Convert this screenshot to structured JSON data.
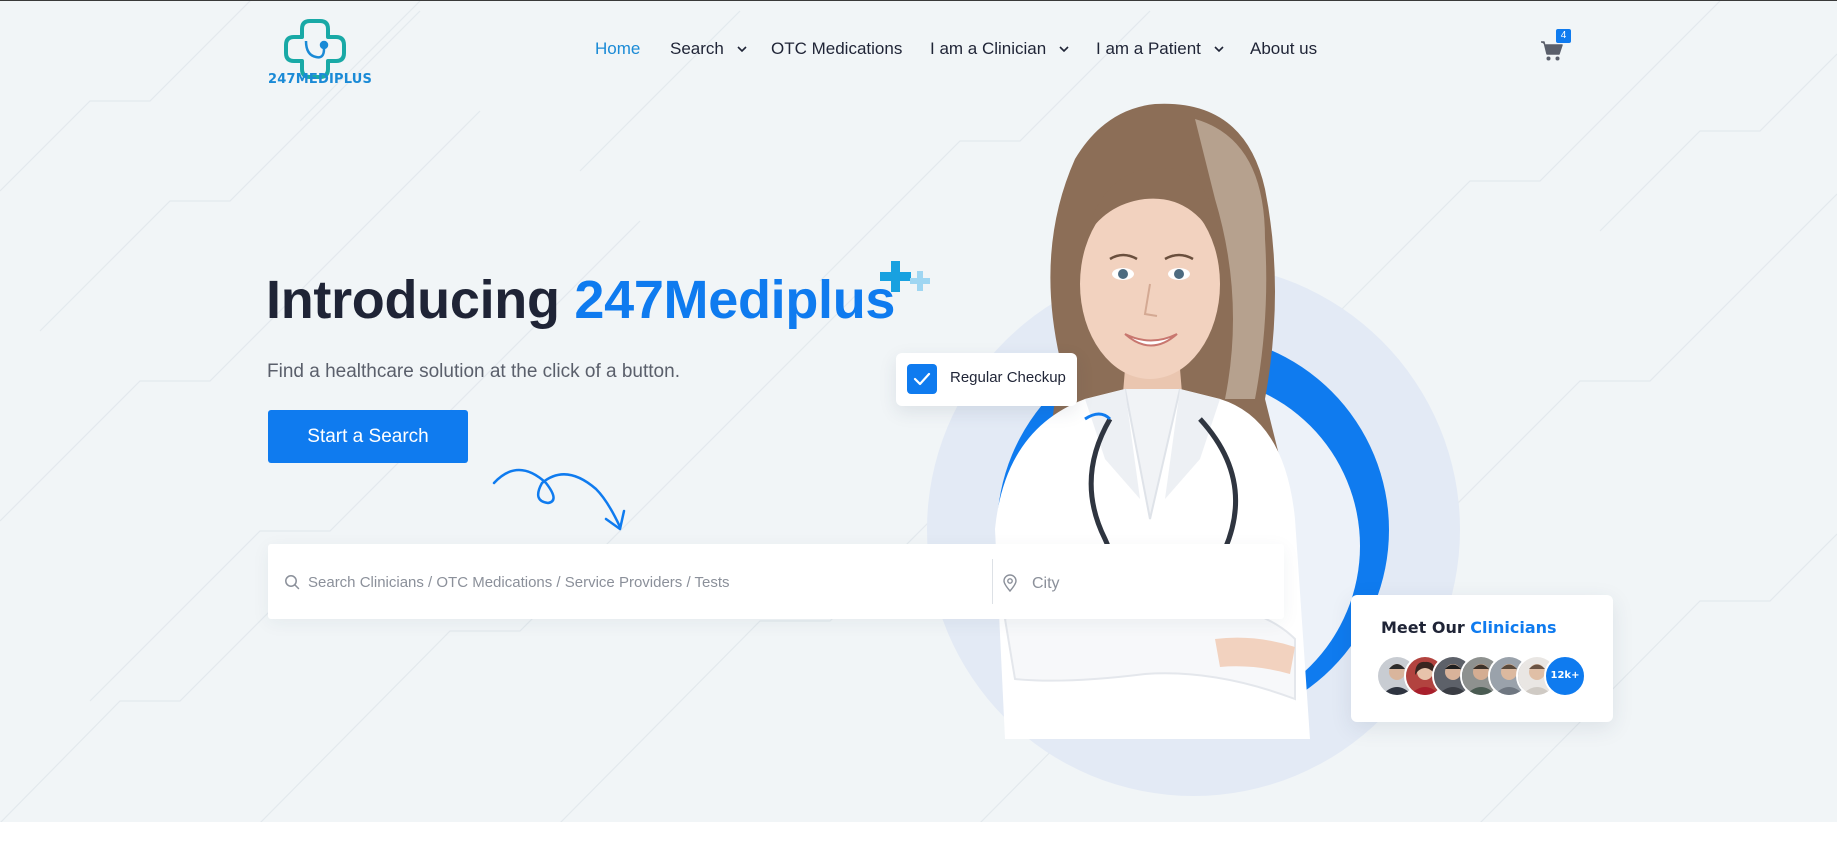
{
  "header": {
    "logo_text": "247MEDIPLUS",
    "nav": [
      {
        "label": "Home",
        "active": true,
        "has_dropdown": false
      },
      {
        "label": "Search",
        "active": false,
        "has_dropdown": true
      },
      {
        "label": "OTC Medications",
        "active": false,
        "has_dropdown": false
      },
      {
        "label": "I am a Clinician",
        "active": false,
        "has_dropdown": true
      },
      {
        "label": "I am a Patient",
        "active": false,
        "has_dropdown": true
      },
      {
        "label": "About us",
        "active": false,
        "has_dropdown": false
      }
    ],
    "cart_icon": "cart-icon",
    "cart_count": "4"
  },
  "hero": {
    "title_prefix": "Introducing ",
    "title_brand": "247Mediplus",
    "subtitle": "Find a healthcare solution at the click of a button.",
    "cta_label": "Start a Search"
  },
  "search": {
    "query_placeholder": "Search Clinicians / OTC Medications / Service Providers / Tests",
    "query_value": "",
    "city_placeholder": "City",
    "city_value": "",
    "search_icon": "search-icon",
    "location_icon": "map-pin-icon"
  },
  "checkup_card": {
    "label": "Regular Checkup",
    "icon": "check-icon"
  },
  "clinicians_card": {
    "title_prefix": "Meet Our ",
    "title_accent": "Clinicians",
    "count_label": "12k+"
  },
  "colors": {
    "accent": "#0f7bef",
    "logo": "#1a8ad6",
    "logo_mark": "#19a9a6",
    "text_dark": "#1f2436",
    "text_muted": "#5a5f6b",
    "hero_bg": "#f1f5f7"
  }
}
